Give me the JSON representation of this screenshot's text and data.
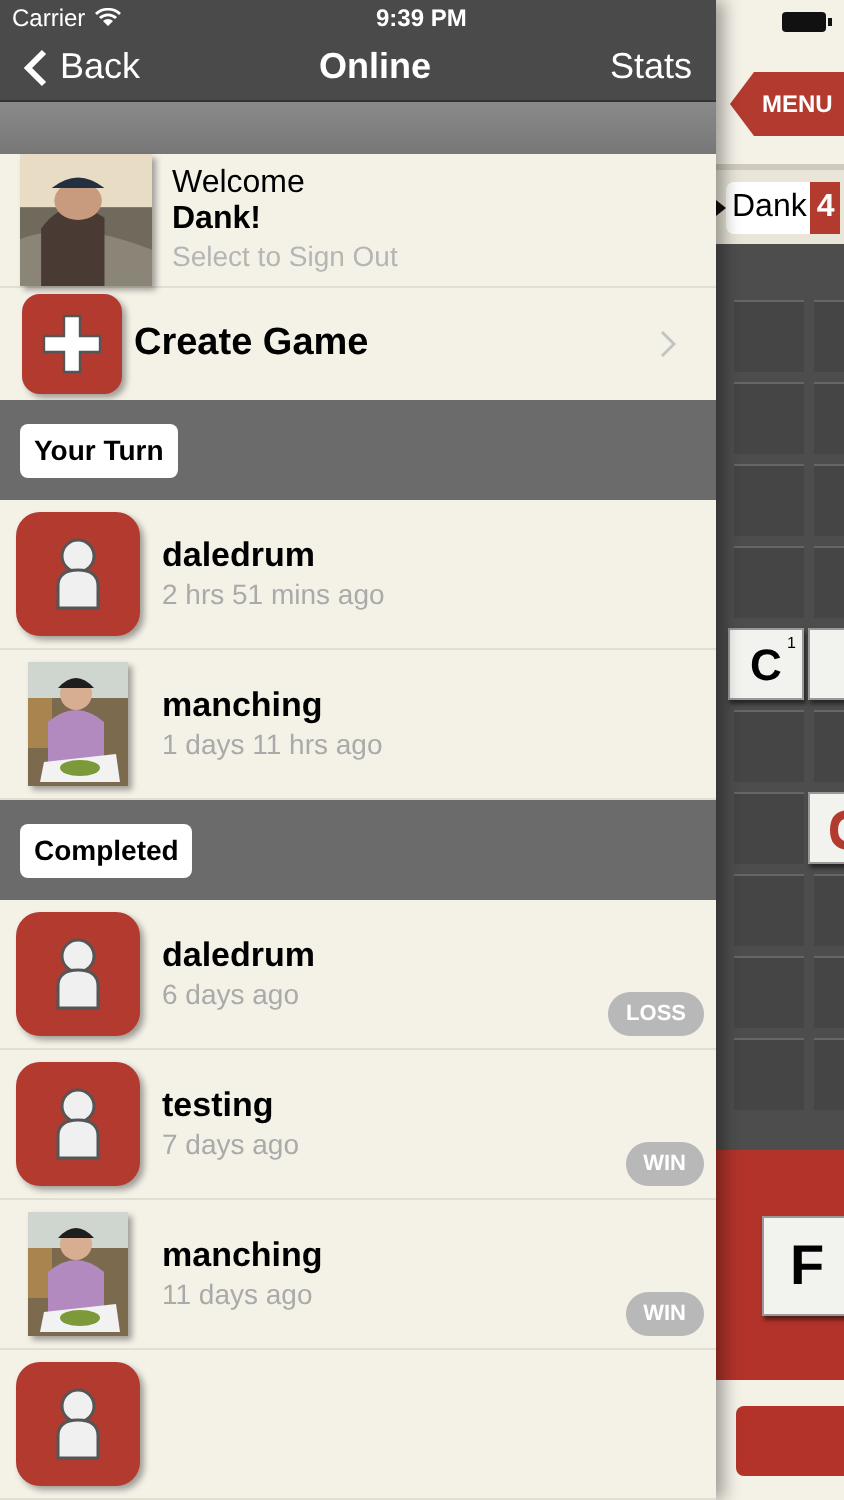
{
  "status_bar": {
    "carrier": "Carrier",
    "time": "9:39 PM"
  },
  "nav": {
    "back": "Back",
    "title": "Online",
    "right": "Stats"
  },
  "welcome": {
    "greeting": "Welcome",
    "name": "Dank!",
    "hint": "Select to Sign Out"
  },
  "create_game": {
    "label": "Create Game"
  },
  "sections": [
    {
      "title": "Your Turn",
      "games": [
        {
          "player": "daledrum",
          "time": "2 hrs 51 mins ago",
          "kind": "icon"
        },
        {
          "player": "manching",
          "time": "1 days 11 hrs ago",
          "kind": "picture"
        }
      ]
    },
    {
      "title": "Completed",
      "games": [
        {
          "player": "daledrum",
          "time": "6 days ago",
          "kind": "icon",
          "result": "LOSS"
        },
        {
          "player": "testing",
          "time": "7 days ago",
          "kind": "icon",
          "result": "WIN"
        },
        {
          "player": "manching",
          "time": "11 days ago",
          "kind": "picture",
          "result": "WIN"
        },
        {
          "kind": "icon"
        }
      ]
    }
  ],
  "board": {
    "menu": "MENU",
    "player": {
      "name": "Dank",
      "score": "4"
    },
    "rows": [
      [
        {
          "kind": "empty"
        },
        {
          "kind": "empty"
        }
      ],
      [
        {
          "kind": "empty"
        },
        {
          "kind": "empty"
        }
      ],
      [
        {
          "kind": "empty"
        },
        {
          "kind": "empty"
        }
      ],
      [
        {
          "kind": "empty"
        },
        {
          "kind": "empty"
        }
      ],
      [
        {
          "kind": "tile",
          "letter": "C",
          "points": "1"
        },
        {
          "kind": "tile"
        }
      ],
      [
        {
          "kind": "empty"
        },
        {
          "kind": "empty"
        }
      ],
      [
        {
          "kind": "empty"
        },
        {
          "kind": "partial"
        }
      ],
      [
        {
          "kind": "empty"
        },
        {
          "kind": "empty"
        }
      ],
      [
        {
          "kind": "empty"
        },
        {
          "kind": "empty"
        }
      ],
      [
        {
          "kind": "empty"
        },
        {
          "kind": "empty"
        }
      ]
    ],
    "rack": [
      {
        "letter": "F"
      }
    ]
  }
}
